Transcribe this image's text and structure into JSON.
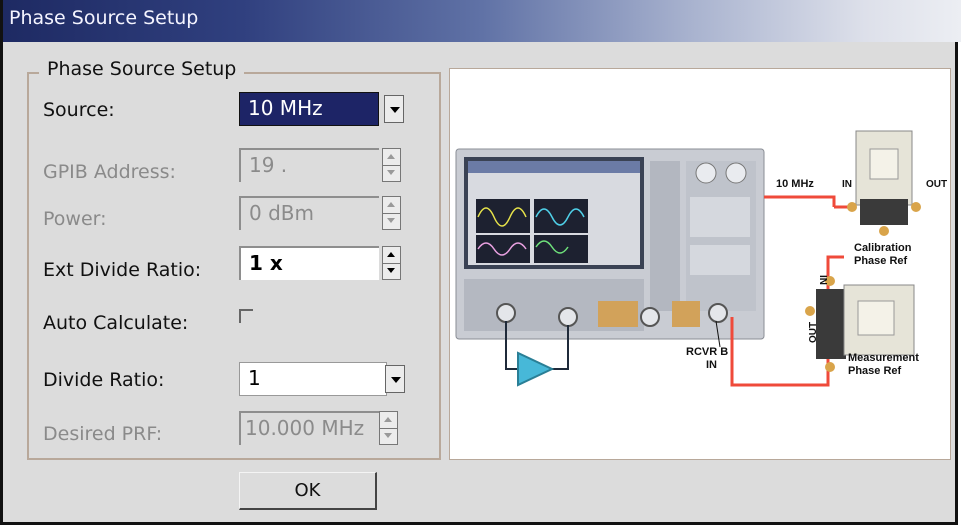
{
  "window": {
    "title": "Phase Source Setup"
  },
  "group": {
    "legend": "Phase Source Setup"
  },
  "form": {
    "source": {
      "label": "Source:",
      "value": "10 MHz"
    },
    "gpib_address": {
      "label": "GPIB Address:",
      "value": "19 ."
    },
    "power": {
      "label": "Power:",
      "value": "0 dBm"
    },
    "ext_divide_ratio": {
      "label": "Ext Divide Ratio:",
      "value": "1 x"
    },
    "auto_calculate": {
      "label": "Auto Calculate:",
      "checked": false
    },
    "divide_ratio": {
      "label": "Divide Ratio:",
      "value": "1"
    },
    "desired_prf": {
      "label": "Desired PRF:",
      "value": "10.000 MHz"
    }
  },
  "buttons": {
    "ok_label": "OK"
  },
  "diagram": {
    "signal_label": "10 MHz",
    "cal_in": "IN",
    "cal_out": "OUT",
    "cal_ref_line1": "Calibration",
    "cal_ref_line2": "Phase Ref",
    "meas_in": "IN",
    "meas_out": "OUT",
    "meas_ref_line1": "Measurement",
    "meas_ref_line2": "Phase Ref",
    "rcvr_line1": "RCVR B",
    "rcvr_line2": "IN",
    "colors": {
      "cable": "#ef4a3a",
      "amplifier": "#47b8d8"
    }
  }
}
